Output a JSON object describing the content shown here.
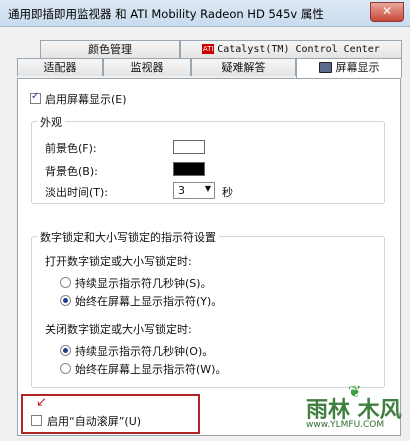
{
  "window": {
    "title": "通用即插即用监视器 和 ATI Mobility Radeon HD 545v 属性",
    "close_glyph": "✕"
  },
  "tabs_top": [
    {
      "label": "颜色管理"
    },
    {
      "label": "Catalyst(TM) Control Center",
      "icon": "ati-logo-icon"
    }
  ],
  "tabs_bottom": [
    {
      "label": "适配器"
    },
    {
      "label": "监视器"
    },
    {
      "label": "疑难解答"
    },
    {
      "label": "屏幕显示",
      "active": true,
      "icon": "monitor-icon"
    }
  ],
  "osd": {
    "enable_label": "启用屏幕显示(E)",
    "enable_checked": true,
    "appearance": {
      "title": "外观",
      "fg_label": "前景色(F):",
      "fg_color": "#ffffff",
      "bg_label": "背景色(B):",
      "bg_color": "#000000",
      "fade_label": "淡出时间(T):",
      "fade_value": "3",
      "fade_unit": "秒"
    },
    "locks": {
      "title": "数字锁定和大小写锁定的指示符设置",
      "on_title": "打开数字锁定或大小写锁定时:",
      "on_options": [
        "持续显示指示符几秒钟(S)。",
        "始终在屏幕上显示指示符(Y)。"
      ],
      "on_selected": 1,
      "off_title": "关闭数字锁定或大小写锁定时:",
      "off_options": [
        "持续显示指示符几秒钟(O)。",
        "始终在屏幕上显示指示符(W)。"
      ],
      "off_selected": 0
    },
    "autoscroll_label": "启用“自动滚屏”(U)",
    "autoscroll_checked": false
  },
  "watermark": {
    "text": "雨林 木风",
    "url": "www.YLMFU.COM"
  },
  "colors": {
    "accent": "#1c3f8c",
    "highlight": "#b22525"
  }
}
